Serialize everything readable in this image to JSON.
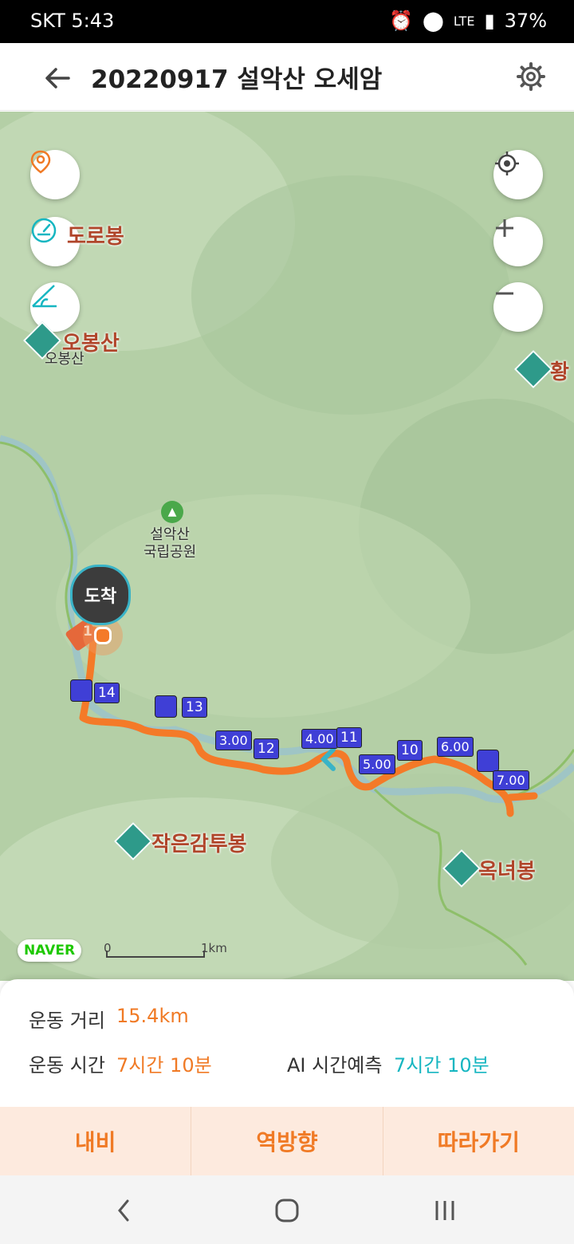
{
  "status": {
    "carrier_time": "SKT 5:43",
    "network": "LTE",
    "battery": "37%"
  },
  "header": {
    "title": "20220917 설악산 오세암"
  },
  "map": {
    "labels": {
      "doro": "도로봉",
      "obong": "오봉산",
      "obong_sub": "오봉산",
      "hwang": "황",
      "park_line1": "설악산",
      "park_line2": "국립공원",
      "jageun": "작은감투봉",
      "okn": "옥녀봉"
    },
    "arrive_label": "도착",
    "markers": [
      "14",
      "13",
      "3.00",
      "12",
      "4.00",
      "11",
      "5.00",
      "10",
      "6.00",
      "7.00"
    ],
    "start_marker": "1",
    "naver": "NAVER",
    "scale": {
      "zero": "0",
      "km": "1km"
    },
    "colors": {
      "track": "#f47a28",
      "pin": "#3f3fd6",
      "ai": "#16b6c1"
    }
  },
  "stats": {
    "distance_label": "운동 거리",
    "distance_value": "15.4km",
    "time_label": "운동 시간",
    "time_value": "7시간 10분",
    "ai_label": "AI 시간예측",
    "ai_value": "7시간 10분"
  },
  "actions": {
    "navi": "내비",
    "reverse": "역방향",
    "follow": "따라가기"
  }
}
